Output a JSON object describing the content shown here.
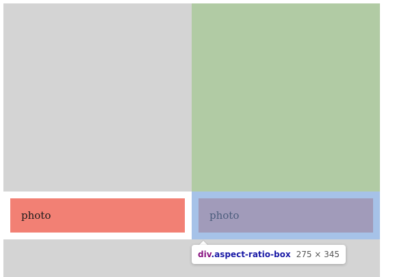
{
  "cards": [
    {
      "caption": "photo"
    },
    {
      "caption": "photo"
    }
  ],
  "inspector_tooltip": {
    "tag": "div",
    "class_name": ".aspect-ratio-box",
    "dimensions": "275 × 345"
  },
  "colors": {
    "gray_box": "#d4d4d4",
    "green_box": "#b1cba4",
    "salmon_card": "#f28074",
    "highlight_padding": "#a6c2e8",
    "highlight_content": "#a19bba"
  }
}
